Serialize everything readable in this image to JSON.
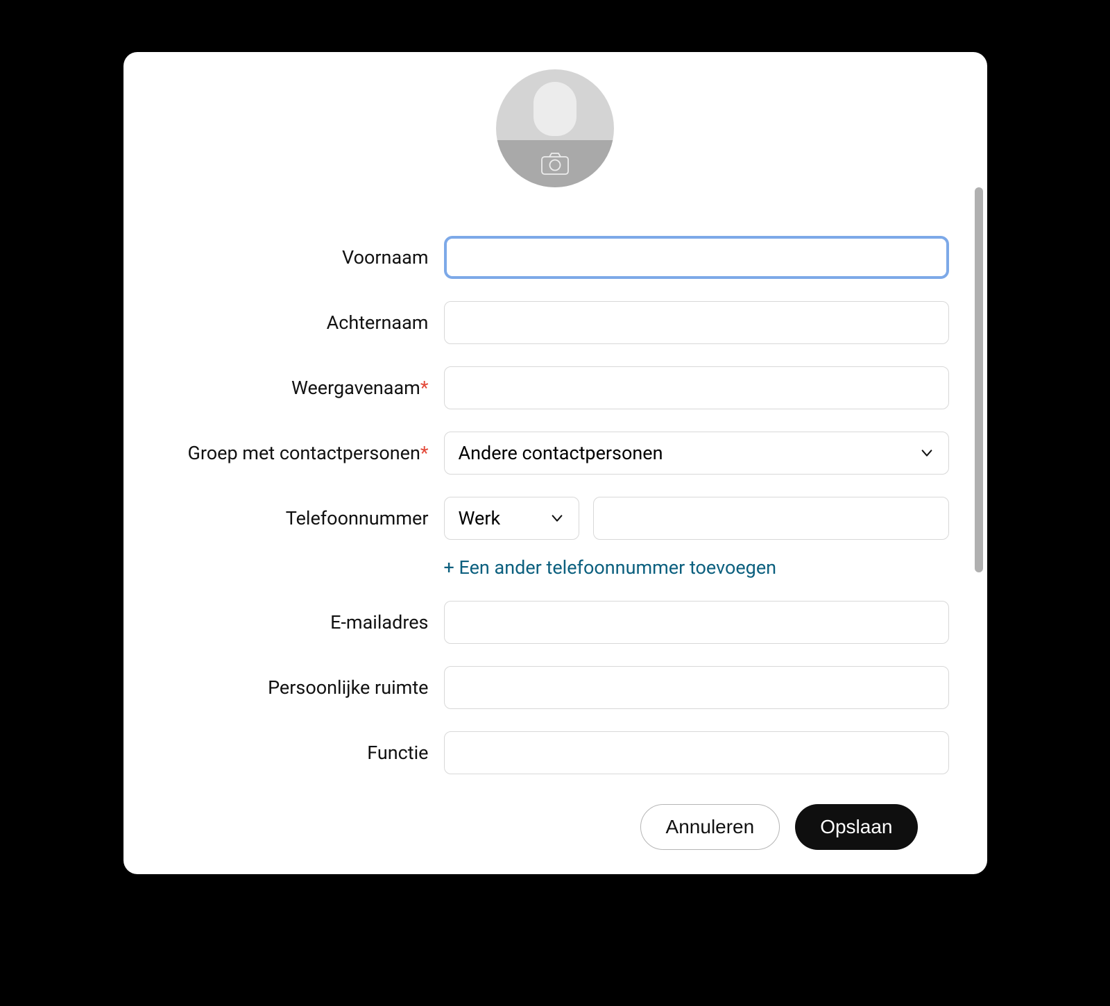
{
  "form": {
    "first_name": {
      "label": "Voornaam",
      "value": ""
    },
    "last_name": {
      "label": "Achternaam",
      "value": ""
    },
    "display_name": {
      "label": "Weergavenaam",
      "required": true,
      "value": ""
    },
    "contact_group": {
      "label": "Groep met contactpersonen",
      "required": true,
      "selected": "Andere contactpersonen"
    },
    "phone": {
      "label": "Telefoonnummer",
      "type_selected": "Werk",
      "value": ""
    },
    "add_phone": "+ Een ander telefoonnummer toevoegen",
    "email": {
      "label": "E-mailadres",
      "value": ""
    },
    "personal_room": {
      "label": "Persoonlijke ruimte",
      "value": ""
    },
    "job_title": {
      "label": "Functie",
      "value": ""
    }
  },
  "required_marker": "*",
  "buttons": {
    "cancel": "Annuleren",
    "save": "Opslaan"
  }
}
